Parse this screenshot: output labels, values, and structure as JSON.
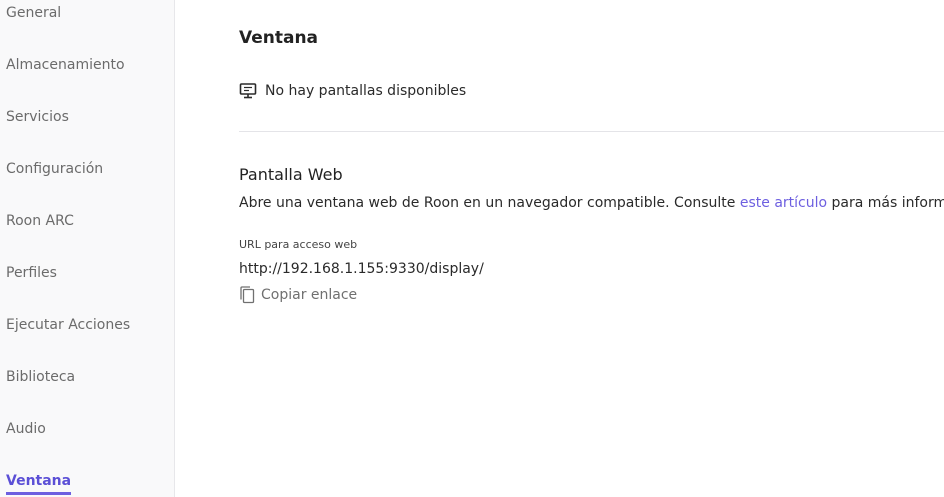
{
  "sidebar": {
    "items": [
      {
        "label": "General"
      },
      {
        "label": "Almacenamiento"
      },
      {
        "label": "Servicios"
      },
      {
        "label": "Configuración"
      },
      {
        "label": "Roon ARC"
      },
      {
        "label": "Perfiles"
      },
      {
        "label": "Ejecutar Acciones"
      },
      {
        "label": "Biblioteca"
      },
      {
        "label": "Audio"
      },
      {
        "label": "Ventana"
      }
    ],
    "active_index": 9
  },
  "main": {
    "title": "Ventana",
    "no_displays": "No hay pantallas disponibles",
    "web_display": {
      "title": "Pantalla Web",
      "description_before": "Abre una ventana web de Roon en un navegador compatible. Consulte ",
      "link_text": "este artículo",
      "description_after": " para más información.",
      "url_label": "URL para acceso web",
      "url": "http://192.168.1.155:9330/display/",
      "copy_label": "Copiar enlace"
    }
  },
  "colors": {
    "accent": "#6d5fe0",
    "sidebar_bg": "#f9f9fa"
  },
  "icons": {
    "no_display": "monitor-icon",
    "copy": "copy-icon"
  }
}
